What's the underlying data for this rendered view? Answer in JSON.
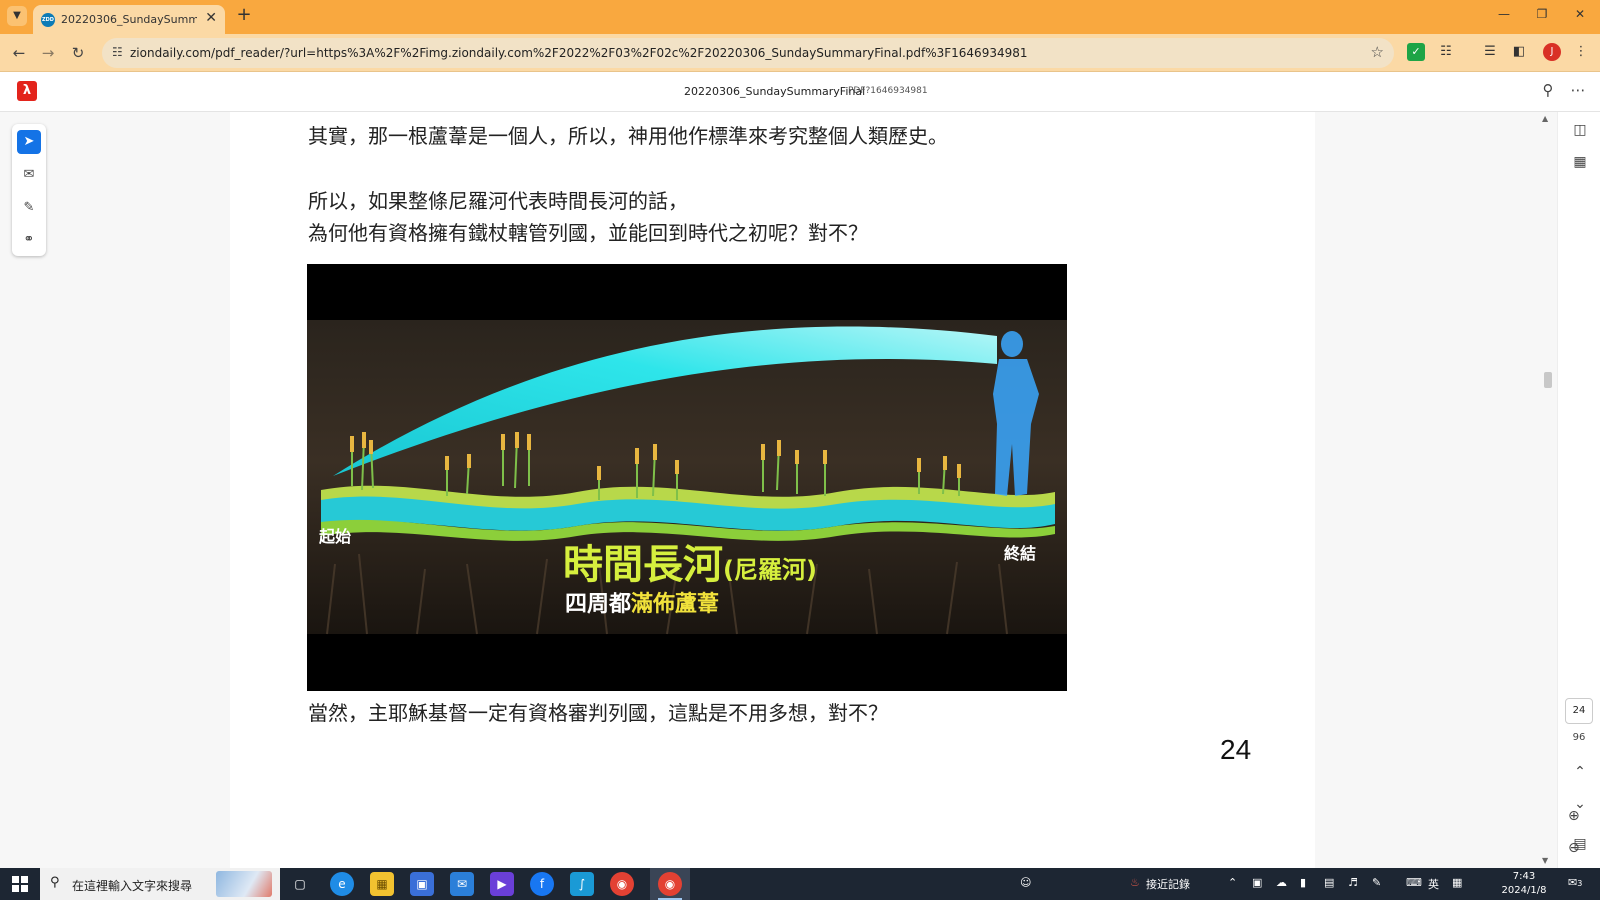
{
  "browser": {
    "tab_title": "20220306_SundaySummaryFi",
    "url": "ziondaily.com/pdf_reader/?url=https%3A%2F%2Fimg.ziondaily.com%2F2022%2F03%2F02c%2F20220306_SundaySummaryFinal.pdf%3F1646934981",
    "profile_initial": "J",
    "favicon_text": "ZDD"
  },
  "viewer": {
    "doc_title": "20220306_SundaySummaryFinal",
    "doc_subtitle": "PDF?1646934981",
    "current_page": "24",
    "total_pages": "96"
  },
  "page": {
    "line1": "其實，那一根蘆葦是一個人，所以，神用他作標準來考究整個人類歷史。",
    "line2": "所以，如果整條尼羅河代表時間長河的話，",
    "line3": "為何他有資格擁有鐵杖轄管列國，並能回到時代之初呢？對不？",
    "line4": "當然，主耶穌基督一定有資格審判列國，這點是不用多想，對不？",
    "page_number": "24"
  },
  "figure": {
    "start_label": "起始",
    "end_label": "終結",
    "title_main": "時間長河",
    "title_paren": "(尼羅河)",
    "subtitle_prefix": "四周都",
    "subtitle_highlight": "滿佈蘆葦",
    "colors": {
      "title": "#d6ef3e",
      "river": "#26c9d6",
      "arc": "#23e1e6",
      "highlight": "#f2e23b"
    }
  },
  "taskbar": {
    "search_placeholder": "在這裡輸入文字來搜尋",
    "weather_text": "接近記錄",
    "ime_label": "英",
    "time": "7:43",
    "date": "2024/1/8",
    "notification_count": "3"
  }
}
